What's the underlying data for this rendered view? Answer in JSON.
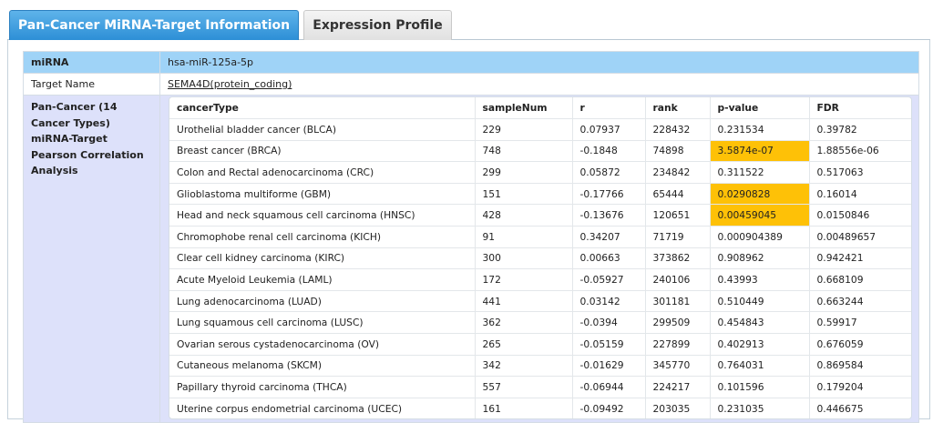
{
  "tabs": [
    {
      "label": "Pan-Cancer MiRNA-Target Information",
      "active": true
    },
    {
      "label": "Expression Profile",
      "active": false
    }
  ],
  "info": {
    "mirna_label": "miRNA",
    "mirna_value": "hsa-miR-125a-5p",
    "target_label": "Target Name",
    "target_value": "SEMA4D(protein_coding)",
    "pan_label": "Pan-Cancer (14 Cancer Types) miRNA-Target Pearson Correlation Analysis"
  },
  "colors": {
    "highlight": "#fec107",
    "header_blue": "#9fd3f7",
    "pan_bg": "#dde1fa"
  },
  "table": {
    "columns": [
      "cancerType",
      "sampleNum",
      "r",
      "rank",
      "p-value",
      "FDR"
    ],
    "rows": [
      {
        "cancerType": "Urothelial bladder cancer (BLCA)",
        "sampleNum": "229",
        "r": "0.07937",
        "rank": "228432",
        "pvalue": "0.231534",
        "fdr": "0.39782",
        "sig": false
      },
      {
        "cancerType": "Breast cancer (BRCA)",
        "sampleNum": "748",
        "r": "-0.1848",
        "rank": "74898",
        "pvalue": "3.5874e-07",
        "fdr": "1.88556e-06",
        "sig": true
      },
      {
        "cancerType": "Colon and Rectal adenocarcinoma (CRC)",
        "sampleNum": "299",
        "r": "0.05872",
        "rank": "234842",
        "pvalue": "0.311522",
        "fdr": "0.517063",
        "sig": false
      },
      {
        "cancerType": "Glioblastoma multiforme (GBM)",
        "sampleNum": "151",
        "r": "-0.17766",
        "rank": "65444",
        "pvalue": "0.0290828",
        "fdr": "0.16014",
        "sig": true
      },
      {
        "cancerType": "Head and neck squamous cell carcinoma (HNSC)",
        "sampleNum": "428",
        "r": "-0.13676",
        "rank": "120651",
        "pvalue": "0.00459045",
        "fdr": "0.0150846",
        "sig": true
      },
      {
        "cancerType": "Chromophobe renal cell carcinoma (KICH)",
        "sampleNum": "91",
        "r": "0.34207",
        "rank": "71719",
        "pvalue": "0.000904389",
        "fdr": "0.00489657",
        "sig": false
      },
      {
        "cancerType": "Clear cell kidney carcinoma (KIRC)",
        "sampleNum": "300",
        "r": "0.00663",
        "rank": "373862",
        "pvalue": "0.908962",
        "fdr": "0.942421",
        "sig": false
      },
      {
        "cancerType": "Acute Myeloid Leukemia (LAML)",
        "sampleNum": "172",
        "r": "-0.05927",
        "rank": "240106",
        "pvalue": "0.43993",
        "fdr": "0.668109",
        "sig": false
      },
      {
        "cancerType": "Lung adenocarcinoma (LUAD)",
        "sampleNum": "441",
        "r": "0.03142",
        "rank": "301181",
        "pvalue": "0.510449",
        "fdr": "0.663244",
        "sig": false
      },
      {
        "cancerType": "Lung squamous cell carcinoma (LUSC)",
        "sampleNum": "362",
        "r": "-0.0394",
        "rank": "299509",
        "pvalue": "0.454843",
        "fdr": "0.59917",
        "sig": false
      },
      {
        "cancerType": "Ovarian serous cystadenocarcinoma (OV)",
        "sampleNum": "265",
        "r": "-0.05159",
        "rank": "227899",
        "pvalue": "0.402913",
        "fdr": "0.676059",
        "sig": false
      },
      {
        "cancerType": "Cutaneous melanoma (SKCM)",
        "sampleNum": "342",
        "r": "-0.01629",
        "rank": "345770",
        "pvalue": "0.764031",
        "fdr": "0.869584",
        "sig": false
      },
      {
        "cancerType": "Papillary thyroid carcinoma (THCA)",
        "sampleNum": "557",
        "r": "-0.06944",
        "rank": "224217",
        "pvalue": "0.101596",
        "fdr": "0.179204",
        "sig": false
      },
      {
        "cancerType": "Uterine corpus endometrial carcinoma (UCEC)",
        "sampleNum": "161",
        "r": "-0.09492",
        "rank": "203035",
        "pvalue": "0.231035",
        "fdr": "0.446675",
        "sig": false
      }
    ]
  }
}
